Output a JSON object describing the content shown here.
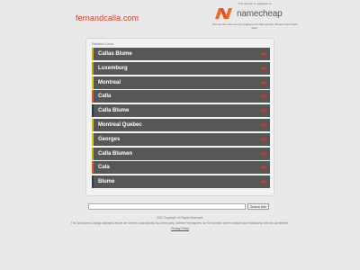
{
  "header": {
    "domain": "fernandcalla.com"
  },
  "registrar": {
    "caption": "This domain is registered at",
    "brand": "namecheap",
    "note": "This domain was recently registered at Namecheap. Please check back later!"
  },
  "related": {
    "label": "Related Links",
    "items": [
      {
        "label": "Callas Blume",
        "accent": "#c8b400"
      },
      {
        "label": "Luxemburg",
        "accent": "#b8a800"
      },
      {
        "label": "Montreal",
        "accent": "#d7d000"
      },
      {
        "label": "Calla",
        "accent": "#e05a2a"
      },
      {
        "label": "Calla Blume",
        "accent": "#1f3a52"
      },
      {
        "label": "Montreal Quebec",
        "accent": "#c8c000"
      },
      {
        "label": "Georges",
        "accent": "#d4cf00"
      },
      {
        "label": "Calla Blumen",
        "accent": "#b8b400"
      },
      {
        "label": "Cala",
        "accent": "#e05a2a"
      },
      {
        "label": "Blume",
        "accent": "#2a3f55"
      }
    ]
  },
  "search": {
    "placeholder": "",
    "button_label": "Search Ads"
  },
  "footer": {
    "copyright": "2020 Copyright. All Rights Reserved.",
    "disclaimer": "The Sponsored Listings displayed above are served automatically by a third party. Neither Parkingcrew nor the domain owner maintain any relationship with the advertisers.",
    "privacy_label": "Privacy Policy"
  },
  "colors": {
    "domain": "#d43c2a",
    "link_bg": "#575757",
    "arrow": "#e0301e",
    "brand_orange": "#f26722"
  }
}
